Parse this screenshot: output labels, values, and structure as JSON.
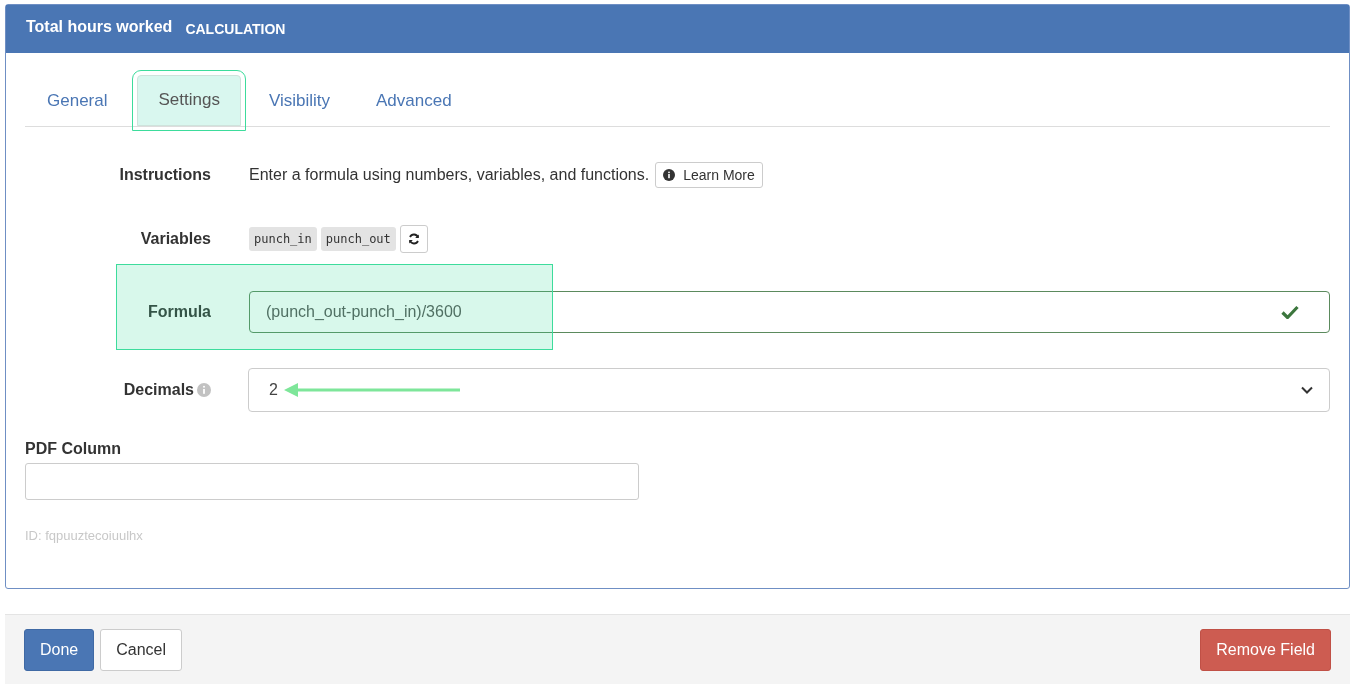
{
  "header": {
    "title": "Total hours worked",
    "type": "CALCULATION"
  },
  "tabs": [
    {
      "label": "General",
      "selected": false
    },
    {
      "label": "Settings",
      "selected": true
    },
    {
      "label": "Visibility",
      "selected": false
    },
    {
      "label": "Advanced",
      "selected": false
    }
  ],
  "instructions": {
    "label": "Instructions",
    "text": "Enter a formula using numbers, variables, and functions.",
    "button": "Learn More"
  },
  "variables": {
    "label": "Variables",
    "items": [
      "punch_in",
      "punch_out"
    ]
  },
  "formula": {
    "label": "Formula",
    "value": "(punch_out-punch_in)/3600",
    "valid": true
  },
  "decimals": {
    "label": "Decimals",
    "value": "2"
  },
  "pdf_column": {
    "label": "PDF Column"
  },
  "id_text": "ID: fqpuuztecoiuulhx",
  "footer": {
    "done": "Done",
    "cancel": "Cancel",
    "remove": "Remove Field"
  }
}
